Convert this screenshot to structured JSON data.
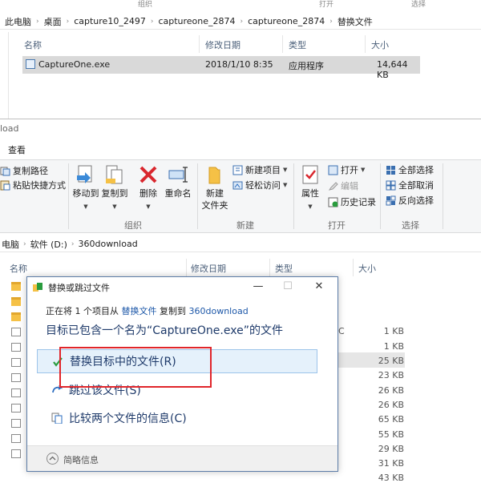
{
  "back_window": {
    "top_labels": [
      "组织",
      "打开",
      "选择"
    ],
    "breadcrumb": [
      "此电脑",
      "桌面",
      "capture10_2497",
      "captureone_2874",
      "captureone_2874",
      "替换文件"
    ],
    "columns": [
      "名称",
      "修改日期",
      "类型",
      "大小"
    ],
    "file": {
      "name": "CaptureOne.exe",
      "date": "2018/1/10 8:35",
      "type": "应用程序",
      "size": "14,644 KB"
    }
  },
  "front_window": {
    "title_fragment": "load",
    "tab_view": "查看",
    "ribbon": {
      "copy_path": "复制路径",
      "paste_shortcut": "粘贴快捷方式",
      "move_to": "移动到",
      "copy_to": "复制到",
      "delete": "删除",
      "rename": "重命名",
      "new_folder": "新建\n文件夹",
      "new_item": "新建项目",
      "easy_access": "轻松访问",
      "properties": "属性",
      "open": "打开",
      "edit": "编辑",
      "history": "历史记录",
      "select_all": "全部选择",
      "select_none": "全部取消",
      "invert": "反向选择",
      "group_organize": "组织",
      "group_new": "新建",
      "group_open": "打开",
      "group_select": "选择"
    },
    "breadcrumb": [
      "电脑",
      "软件 (D:)",
      "360download"
    ],
    "columns": [
      "名称",
      "修改日期",
      "类型",
      "大小"
    ],
    "sizes": [
      "1 KB",
      "1 KB",
      "25 KB",
      "23 KB",
      "26 KB",
      "26 KB",
      "65 KB",
      "55 KB",
      "29 KB",
      "31 KB",
      "43 KB"
    ],
    "partial_text": "C"
  },
  "dialog": {
    "title": "替换或跳过文件",
    "status_prefix": "正在将 1 个项目从",
    "status_source": "替换文件",
    "status_mid": "复制到",
    "status_dest": "360download",
    "heading": "目标已包含一个名为“CaptureOne.exe”的文件",
    "option_replace": "替换目标中的文件(R)",
    "option_skip": "跳过该文件(S)",
    "option_compare": "比较两个文件的信息(C)",
    "footer": "简略信息"
  },
  "colors": {
    "accent": "#1c57a8",
    "highlight_border": "#e0252a",
    "selected_option": "#e5f1fb"
  }
}
